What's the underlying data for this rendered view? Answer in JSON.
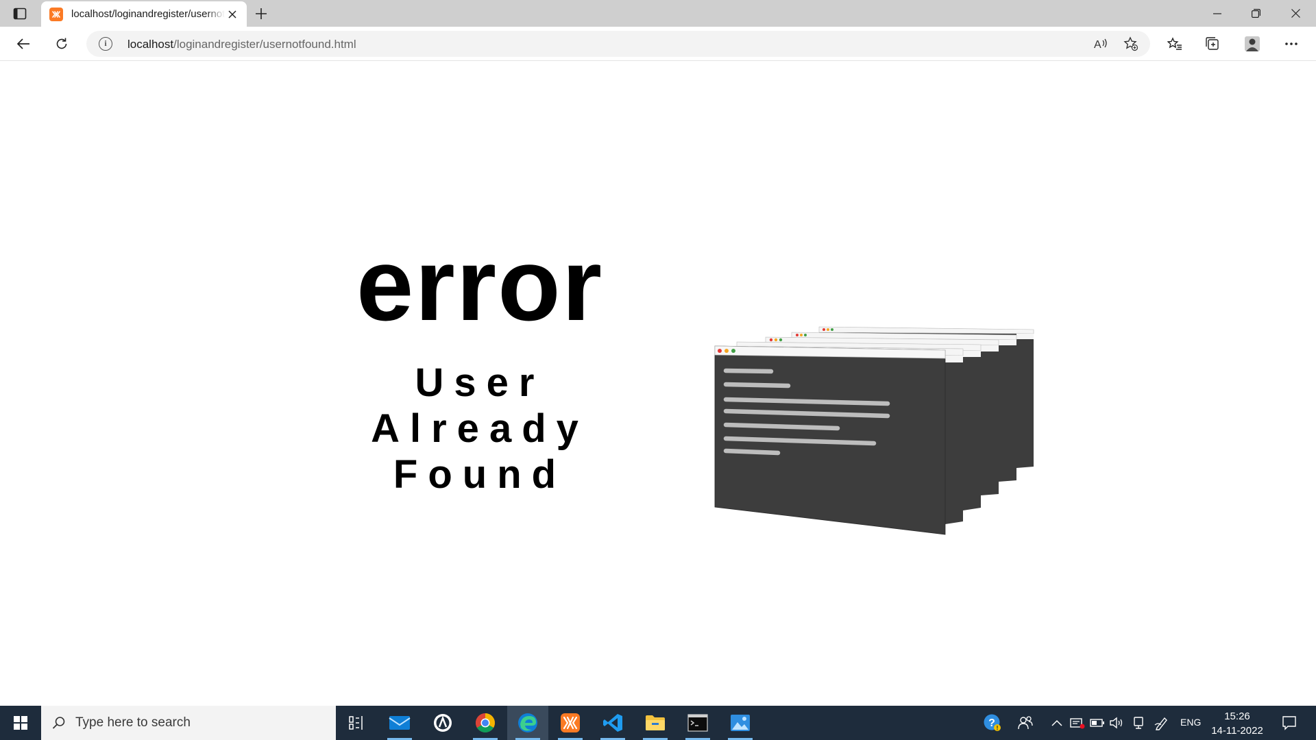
{
  "browser": {
    "tab_title": "localhost/loginandregister/usernotfound.html",
    "address": {
      "host": "localhost",
      "path": "/loginandregister/usernotfound.html"
    }
  },
  "page": {
    "error_title": "error",
    "message_lines": [
      "User",
      "Already",
      "Found"
    ]
  },
  "taskbar": {
    "search_placeholder": "Type here to search",
    "apps": [
      "task-view",
      "mail",
      "app",
      "chrome",
      "edge",
      "xampp",
      "vscode",
      "file-explorer",
      "terminal",
      "photos"
    ],
    "language": "ENG",
    "time": "15:26",
    "date": "14-11-2022"
  },
  "colors": {
    "tabbar": "#cfcfcf",
    "taskbar": "#1e2c3c",
    "window_body": "#3d3d3d",
    "xampp_orange": "#fb7a24",
    "edge_blue": "#0f7fd6"
  }
}
